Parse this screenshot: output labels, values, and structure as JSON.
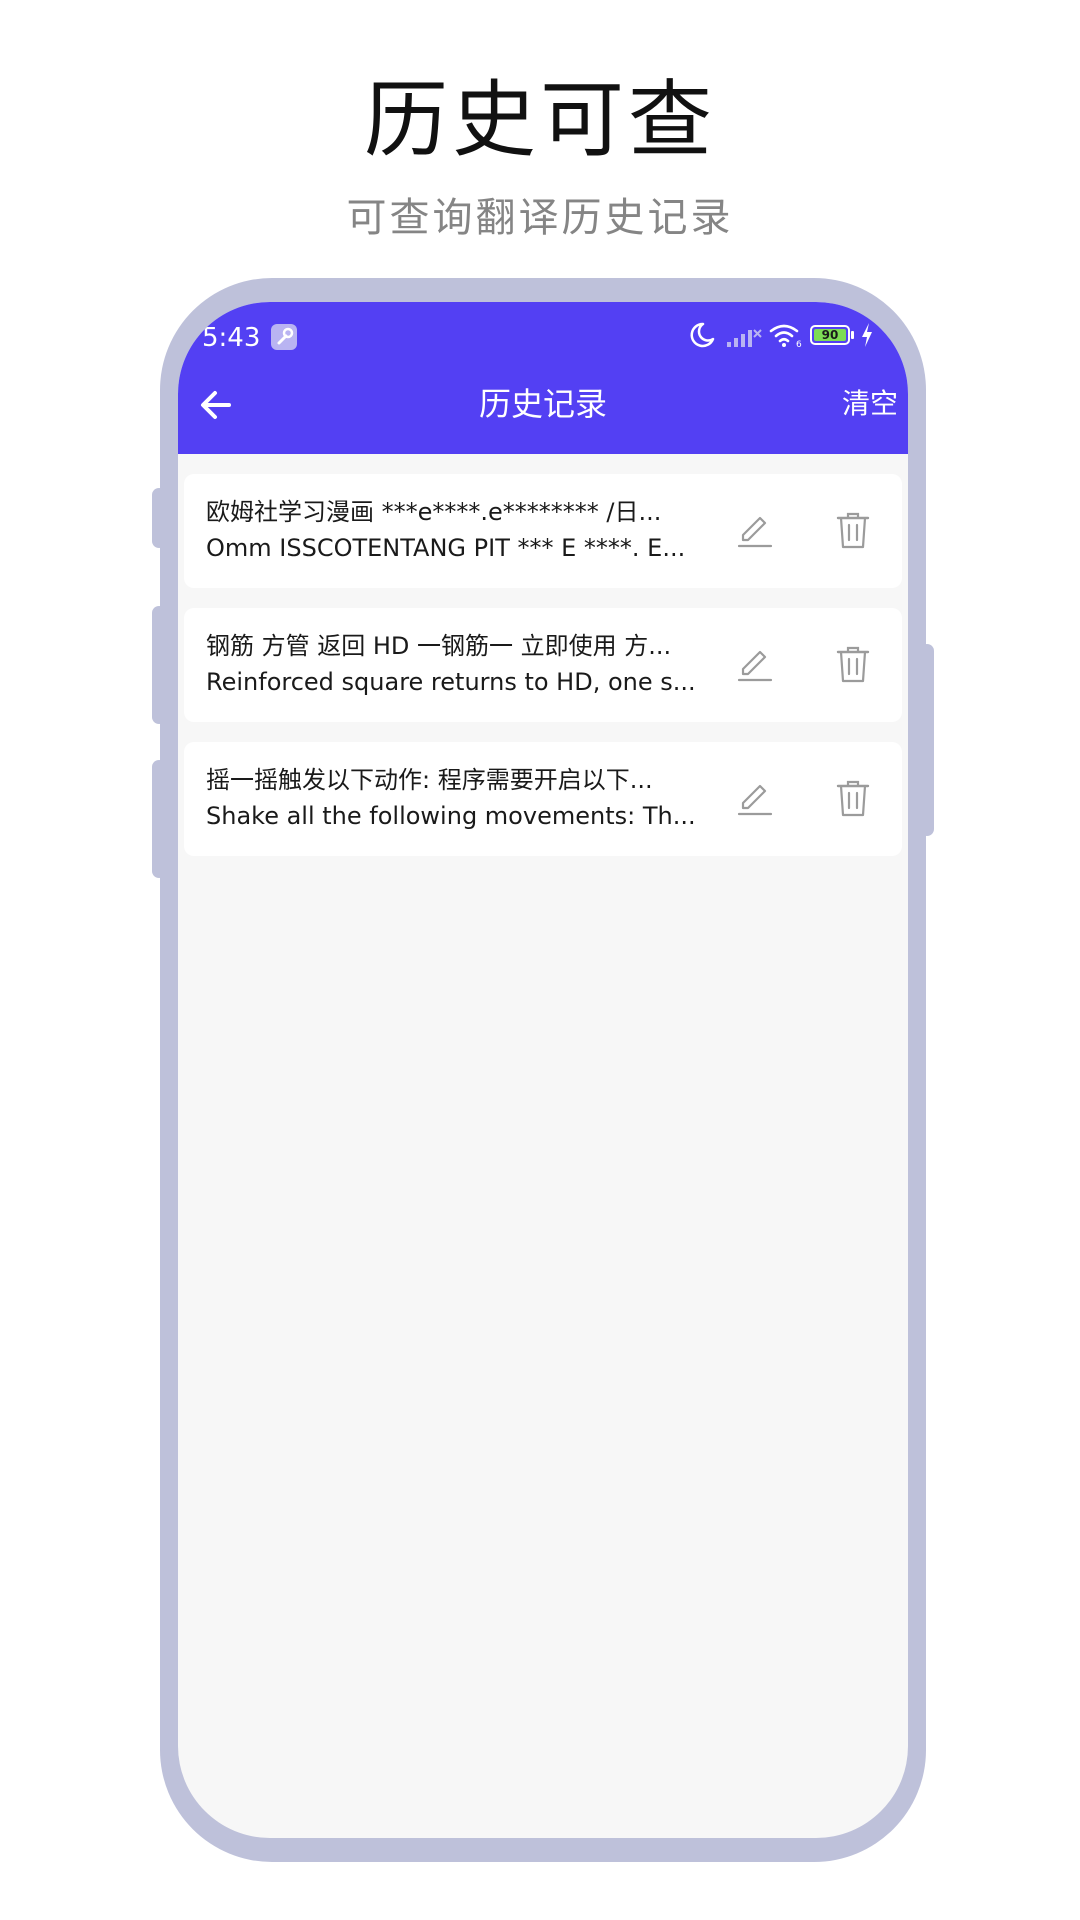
{
  "promo": {
    "title": "历史可查",
    "subtitle": "可查询翻译历史记录"
  },
  "status_bar": {
    "time": "5:43",
    "battery_level": "90",
    "icons": [
      "wrench-icon",
      "moon-icon",
      "signal-off-icon",
      "wifi-icon",
      "battery-icon",
      "charging-icon"
    ]
  },
  "header": {
    "title": "历史记录",
    "clear_label": "清空",
    "back_icon": "arrow-left-icon"
  },
  "history": [
    {
      "source": "欧姆社学习漫画 ***e****.e******** /日...",
      "translation": "Omm ISSCOTENTANG PIT *** E ****. E..."
    },
    {
      "source": "钢筋 方管 返回 HD 一钢筋一 立即使用 方...",
      "translation": "Reinforced square returns to HD, one s..."
    },
    {
      "source": "摇一摇触发以下动作: 程序需要开启以下...",
      "translation": "Shake all the following movements: Th..."
    }
  ],
  "colors": {
    "accent": "#5340f3",
    "frame": "#bec1da",
    "screen_bg": "#f7f7f7",
    "icon_gray": "#9b9b9b",
    "battery_green": "#7ddc55"
  }
}
